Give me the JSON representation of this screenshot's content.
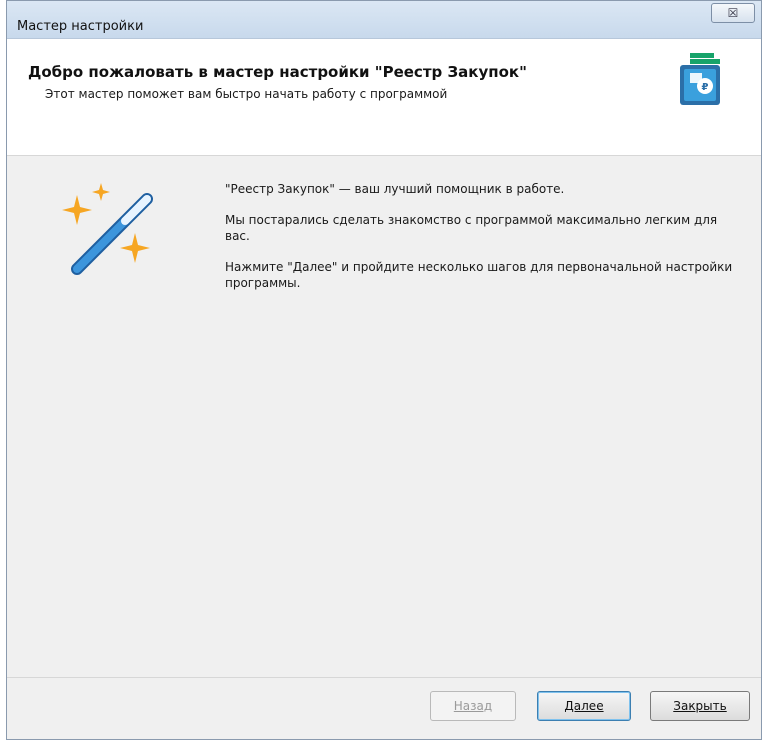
{
  "window": {
    "title": "Мастер настройки",
    "close_glyph": "☒"
  },
  "header": {
    "title": "Добро пожаловать в мастер настройки \"Реестр Закупок\"",
    "subtitle": "Этот мастер поможет вам быстро начать работу с программой",
    "app_icon": "registry-app-icon"
  },
  "content": {
    "illustration": "magic-wand-icon",
    "paragraphs": [
      "\"Реестр Закупок\" — ваш лучший помощник в работе.",
      "Мы постарались сделать знакомство с программой максимально легким для вас.",
      "Нажмите \"Далее\" и пройдите несколько шагов для первоначальной настройки программы."
    ]
  },
  "buttons": {
    "back_label": "Назад",
    "next_label": "Далее",
    "close_label": "Закрыть"
  },
  "colors": {
    "accent": "#3c7fb1",
    "icon_green": "#17a36a",
    "icon_blue": "#2b6fa8",
    "sparkle": "#f6a623"
  }
}
